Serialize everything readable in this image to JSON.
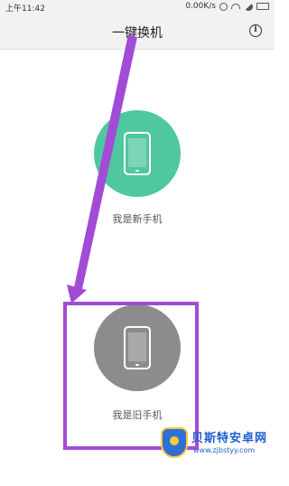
{
  "status_bar": {
    "time": "上午11:42",
    "speed": "0.00K/s",
    "icons": [
      "alarm-icon",
      "wifi-icon",
      "signal-icon",
      "battery-icon"
    ]
  },
  "header": {
    "title": "一键换机",
    "info_icon": "i"
  },
  "options": {
    "new_phone": {
      "label": "我是新手机",
      "color": "#4fc79f",
      "icon": "phone-icon"
    },
    "old_phone": {
      "label": "我是旧手机",
      "color": "#8c8c8c",
      "icon": "phone-icon"
    }
  },
  "annotation": {
    "color": "#a24bd6"
  },
  "watermark": {
    "title": "贝斯特安卓网",
    "url": "www.zjbstyy.com"
  }
}
